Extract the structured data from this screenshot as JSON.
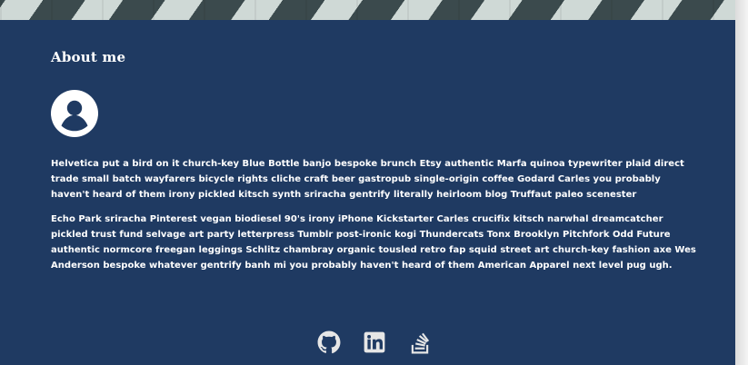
{
  "section": {
    "title": "About me",
    "paragraphs": [
      "Helvetica put a bird on it church-key Blue Bottle banjo bespoke brunch Etsy authentic Marfa quinoa typewriter plaid direct trade small batch wayfarers bicycle rights cliche craft beer gastropub single-origin coffee Godard Carles you probably haven't heard of them irony pickled kitsch synth sriracha gentrify literally heirloom blog Truffaut paleo scenester",
      "Echo Park sriracha Pinterest vegan biodiesel 90's irony iPhone Kickstarter Carles crucifix kitsch narwhal dreamcatcher pickled trust fund selvage art party letterpress Tumblr post-ironic kogi Thundercats Tonx Brooklyn Pitchfork Odd Future authentic normcore freegan leggings Schlitz chambray organic tousled retro fap squid street art church-key fashion axe Wes Anderson bespoke whatever gentrify banh mi you probably haven't heard of them American Apparel next level pug ugh."
    ]
  },
  "social_links": [
    {
      "icon": "github-icon"
    },
    {
      "icon": "linkedin-icon"
    },
    {
      "icon": "stackoverflow-icon"
    }
  ],
  "colors": {
    "section_bg": "#1f3a62",
    "text": "#ffffff",
    "icon": "#e6e6e6"
  }
}
